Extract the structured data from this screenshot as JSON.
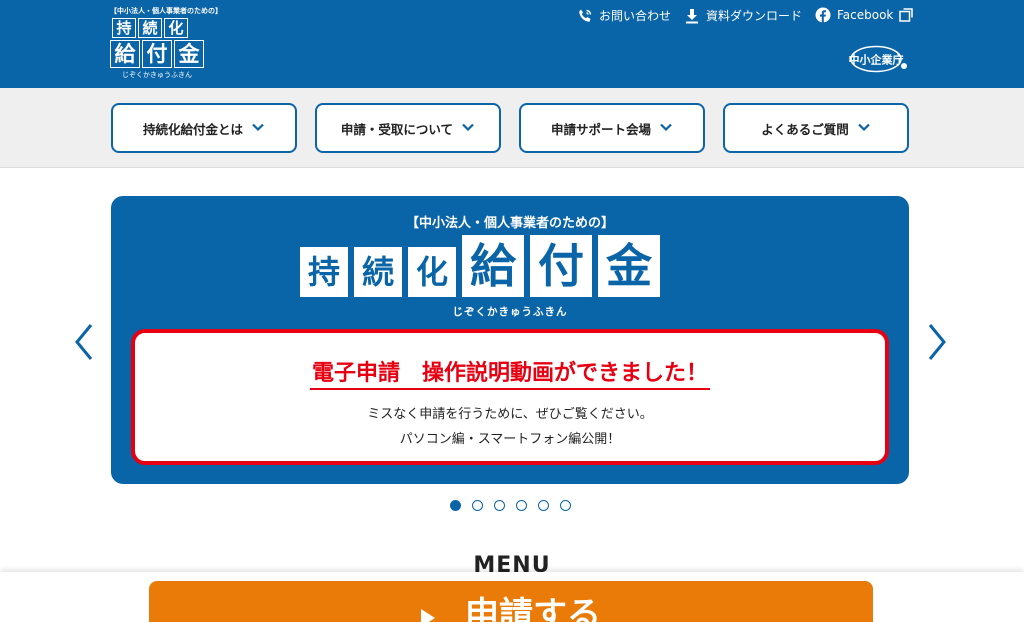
{
  "header": {
    "logo": {
      "tagline": "【中小法人・個人事業者のための】",
      "row1": [
        "持",
        "続",
        "化"
      ],
      "row2": [
        "給",
        "付",
        "金"
      ],
      "kana": "じぞくかきゅうふきん"
    },
    "links": {
      "contact": "お問い合わせ",
      "download": "資料ダウンロード",
      "facebook": "Facebook"
    },
    "ministry_label": "中小企業庁"
  },
  "nav": {
    "items": [
      {
        "label": "持続化給付金とは"
      },
      {
        "label": "申請・受取について"
      },
      {
        "label": "申請サポート会場"
      },
      {
        "label": "よくあるご質問"
      }
    ]
  },
  "hero": {
    "subtitle": "【中小法人・個人事業者のための】",
    "kanji_small": [
      "持",
      "続",
      "化"
    ],
    "kanji_large": [
      "給",
      "付",
      "金"
    ],
    "kana": "じぞくかきゅうふきん",
    "notice": {
      "title": "電子申請　操作説明動画ができました！",
      "line1": "ミスなく申請を行うために、ぜひご覧ください。",
      "line2": "パソコン編・スマートフォン編公開！"
    }
  },
  "carousel": {
    "slide_count": 6,
    "active_index": 0
  },
  "menu": {
    "heading": "MENU"
  },
  "apply": {
    "label": "申請する"
  },
  "colors": {
    "primary": "#0a64a8",
    "alert": "#e60012",
    "apply": "#ea7b08",
    "nav_band": "#efefef"
  }
}
